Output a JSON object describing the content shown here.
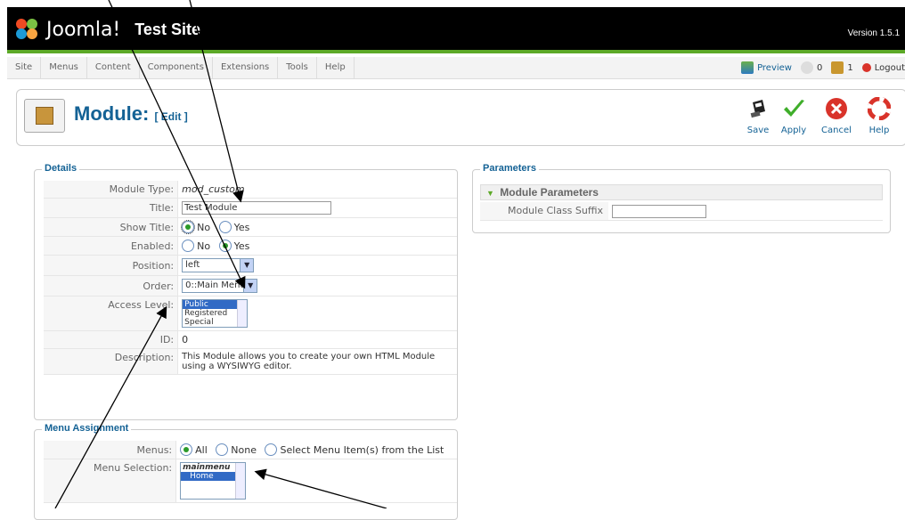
{
  "header": {
    "brand": "Joomla!",
    "site_name": "Test Site",
    "version": "Version 1.5.1"
  },
  "menubar": {
    "items": [
      {
        "label": "Site"
      },
      {
        "label": "Menus"
      },
      {
        "label": "Content"
      },
      {
        "label": "Components"
      },
      {
        "label": "Extensions"
      },
      {
        "label": "Tools"
      },
      {
        "label": "Help"
      }
    ],
    "preview": "Preview",
    "messages_count": "0",
    "users_count": "1",
    "logout": "Logout"
  },
  "toolbar": {
    "title": "Module:",
    "subtitle": "[ Edit ]",
    "save": "Save",
    "apply": "Apply",
    "cancel": "Cancel",
    "help": "Help"
  },
  "details": {
    "legend": "Details",
    "module_type_label": "Module Type:",
    "module_type_value": "mod_custom",
    "title_label": "Title:",
    "title_value": "Test Module",
    "show_title_label": "Show Title:",
    "no": "No",
    "yes": "Yes",
    "enabled_label": "Enabled:",
    "position_label": "Position:",
    "position_value": "left",
    "order_label": "Order:",
    "order_value": "0::Main Menu",
    "access_label": "Access Level:",
    "access_options": [
      "Public",
      "Registered",
      "Special"
    ],
    "id_label": "ID:",
    "id_value": "0",
    "description_label": "Description:",
    "description_value": "This Module allows you to create your own HTML Module using a WYSIWYG editor."
  },
  "menu_assignment": {
    "legend": "Menu Assignment",
    "menus_label": "Menus:",
    "all": "All",
    "none": "None",
    "select_list": "Select Menu Item(s) from the List",
    "selection_label": "Menu Selection:",
    "selection_group": "mainmenu",
    "selection_item": "Home"
  },
  "parameters": {
    "legend": "Parameters",
    "section": "Module Parameters",
    "class_suffix_label": "Module Class Suffix"
  },
  "colors": {
    "accent": "#146295",
    "header_bg": "#000000",
    "header_bar": "#5ca927"
  }
}
